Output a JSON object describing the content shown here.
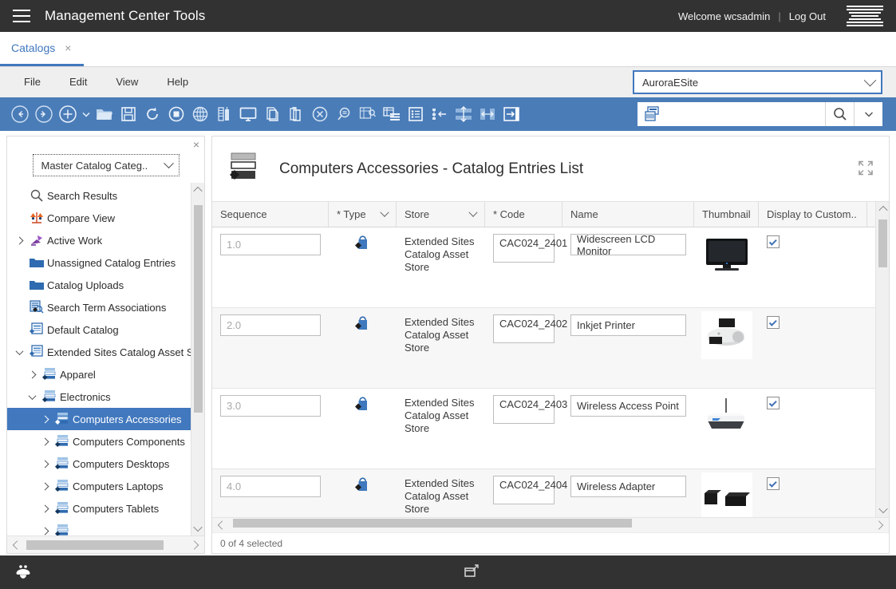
{
  "masthead": {
    "menu_icon": "hamburger-icon",
    "title": "Management Center Tools",
    "welcome": "Welcome wcsadmin",
    "separator": "|",
    "logout": "Log Out",
    "logo": "ibm-logo",
    "bg": "#323232"
  },
  "tabs": [
    {
      "label": "Catalogs",
      "close": "×",
      "active": true
    }
  ],
  "menubar": {
    "items": [
      "File",
      "Edit",
      "View",
      "Help"
    ],
    "store_select": {
      "value": "AuroraESite",
      "icon": "chevron-down-icon",
      "border": "#4178be"
    }
  },
  "toolbar": {
    "bg": "#4a7cb8",
    "buttons": [
      {
        "name": "back-icon",
        "title": "Back"
      },
      {
        "name": "forward-icon",
        "title": "Forward"
      },
      {
        "name": "new-icon",
        "title": "New"
      },
      {
        "name": "new-dropdown-caret-icon",
        "title": "New options"
      },
      {
        "name": "open-folder-icon",
        "title": "Open"
      },
      {
        "name": "save-icon",
        "title": "Save"
      },
      {
        "name": "refresh-icon",
        "title": "Refresh"
      },
      {
        "name": "stop-icon",
        "title": "Stop"
      },
      {
        "name": "globe-icon",
        "title": "Globalization"
      },
      {
        "name": "manage-assets-icon",
        "title": "Manage Assets"
      },
      {
        "name": "preview-monitor-icon",
        "title": "Preview"
      },
      {
        "name": "copy-icon",
        "title": "Copy"
      },
      {
        "name": "paste-icon",
        "title": "Paste"
      },
      {
        "name": "delete-circle-icon",
        "title": "Delete"
      },
      {
        "name": "find-icon",
        "title": "Find"
      },
      {
        "name": "find-replace-grid-icon",
        "title": "Find and Replace"
      },
      {
        "name": "list-view-icon",
        "title": "List View"
      },
      {
        "name": "properties-list-icon",
        "title": "Properties View"
      },
      {
        "name": "collapse-tree-icon",
        "title": "Collapse Tree"
      },
      {
        "name": "split-horizontal-icon",
        "title": "Split Horizontal"
      },
      {
        "name": "split-vertical-icon",
        "title": "Split Vertical"
      },
      {
        "name": "show-panel-icon",
        "title": "Show Panel"
      }
    ],
    "search": {
      "icon": "catalog-search-icon",
      "value": "",
      "placeholder": "",
      "search_button": "search-icon",
      "dropdown": "chevron-down-icon"
    }
  },
  "explorer": {
    "close": "×",
    "filter": {
      "value": "Master Catalog Categ..",
      "icon": "chevron-down-icon"
    },
    "tree": [
      {
        "label": "Search Results",
        "icon": "search-icon",
        "indent": 0,
        "twisty": "none",
        "selected": false
      },
      {
        "label": "Compare View",
        "icon": "compare-scales-icon",
        "indent": 0,
        "twisty": "none",
        "selected": false
      },
      {
        "label": "Active Work",
        "icon": "active-work-icon",
        "indent": 0,
        "twisty": "closed",
        "selected": false
      },
      {
        "label": "Unassigned Catalog Entries",
        "icon": "folder-icon",
        "indent": 0,
        "twisty": "none",
        "selected": false
      },
      {
        "label": "Catalog Uploads",
        "icon": "folder-icon",
        "indent": 0,
        "twisty": "none",
        "selected": false
      },
      {
        "label": "Search Term Associations",
        "icon": "search-term-icon",
        "indent": 0,
        "twisty": "none",
        "selected": false
      },
      {
        "label": "Default Catalog",
        "icon": "catalog-icon",
        "indent": 0,
        "twisty": "none",
        "selected": false
      },
      {
        "label": "Extended Sites Catalog Asset S",
        "icon": "catalog-icon",
        "indent": 0,
        "twisty": "open",
        "selected": false
      },
      {
        "label": "Apparel",
        "icon": "category-icon",
        "indent": 1,
        "twisty": "closed",
        "selected": false
      },
      {
        "label": "Electronics",
        "icon": "category-icon",
        "indent": 1,
        "twisty": "open",
        "selected": false
      },
      {
        "label": "Computers Accessories",
        "icon": "category-icon",
        "indent": 2,
        "twisty": "closed",
        "selected": true
      },
      {
        "label": "Computers Components",
        "icon": "category-icon",
        "indent": 2,
        "twisty": "closed",
        "selected": false
      },
      {
        "label": "Computers Desktops",
        "icon": "category-icon",
        "indent": 2,
        "twisty": "closed",
        "selected": false
      },
      {
        "label": "Computers Laptops",
        "icon": "category-icon",
        "indent": 2,
        "twisty": "closed",
        "selected": false
      },
      {
        "label": "Computers Tablets",
        "icon": "category-icon",
        "indent": 2,
        "twisty": "closed",
        "selected": false
      }
    ],
    "selection_color": "#4178be"
  },
  "panel": {
    "icon": "catalog-category-icon",
    "title": "Computers Accessories - Catalog Entries List",
    "expand_icon": "expand-icon"
  },
  "grid": {
    "columns": [
      {
        "label": "Sequence",
        "sortable": false
      },
      {
        "label": "* Type",
        "sortable": true
      },
      {
        "label": "Store",
        "sortable": true
      },
      {
        "label": "* Code",
        "sortable": false
      },
      {
        "label": "Name",
        "sortable": false
      },
      {
        "label": "Thumbnail",
        "sortable": false
      },
      {
        "label": "Display to Custom..",
        "sortable": false
      }
    ],
    "rows": [
      {
        "sequence": "1.0",
        "type_icon": "product-bag-icon",
        "store": "Extended Sites Catalog Asset Store",
        "code": "CAC024_2401",
        "name": "Widescreen LCD Monitor",
        "thumbnail": "lcd-monitor-thumbnail",
        "display_to_customers": true
      },
      {
        "sequence": "2.0",
        "type_icon": "product-bag-icon",
        "store": "Extended Sites Catalog Asset Store",
        "code": "CAC024_2402",
        "name": "Inkjet Printer",
        "thumbnail": "inkjet-printer-thumbnail",
        "display_to_customers": true
      },
      {
        "sequence": "3.0",
        "type_icon": "product-bag-icon",
        "store": "Extended Sites Catalog Asset Store",
        "code": "CAC024_2403",
        "name": "Wireless Access Point",
        "thumbnail": "wireless-access-point-thumbnail",
        "display_to_customers": true
      },
      {
        "sequence": "4.0",
        "type_icon": "product-bag-icon",
        "store": "Extended Sites Catalog Asset Store",
        "code": "CAC024_2404",
        "name": "Wireless Adapter",
        "thumbnail": "wireless-adapter-thumbnail",
        "display_to_customers": true
      }
    ],
    "status": "0 of 4 selected"
  },
  "footer": {
    "bg": "#323232",
    "left_icon": "bee-icon",
    "center_icon": "restore-window-icon"
  }
}
